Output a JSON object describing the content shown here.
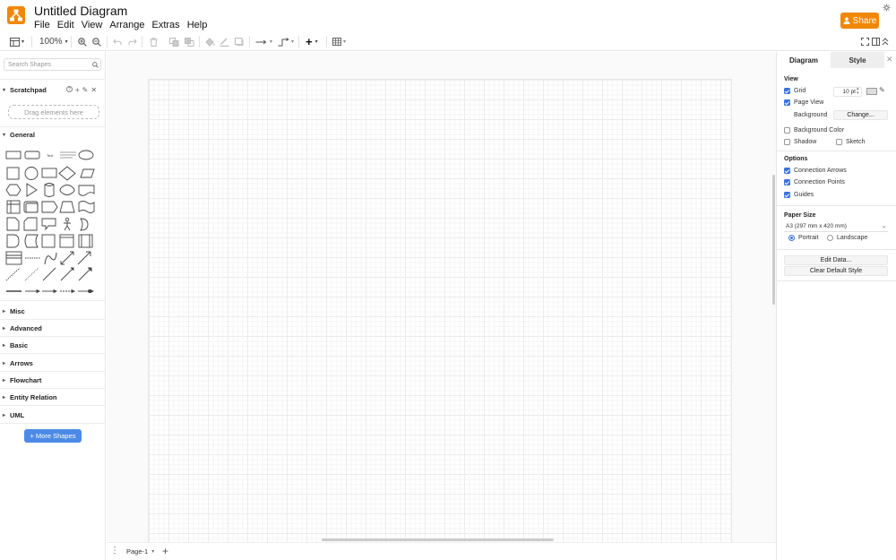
{
  "app": {
    "title": "Untitled Diagram",
    "brand_color": "#f08705",
    "accent_color": "#4d8ae8"
  },
  "menu": [
    "File",
    "Edit",
    "View",
    "Arrange",
    "Extras",
    "Help"
  ],
  "share": {
    "label": "Share",
    "icon": "user-icon"
  },
  "toolbar": {
    "zoom": "100%",
    "icons": [
      "format-panel-icon",
      "zoom-in-icon",
      "zoom-out-icon",
      "undo-icon",
      "redo-icon",
      "delete-icon",
      "to-front-icon",
      "to-back-icon",
      "fill-color-icon",
      "line-color-icon",
      "shadow-icon",
      "connection-icon",
      "waypoints-icon",
      "insert-icon",
      "table-icon",
      "fullscreen-icon",
      "format-toggle-icon",
      "collapse-icon"
    ]
  },
  "sidebar": {
    "search_placeholder": "Search Shapes",
    "scratchpad": "Scratchpad",
    "drop_hint": "Drag elements here",
    "general": "General",
    "sections": [
      "Misc",
      "Advanced",
      "Basic",
      "Arrows",
      "Flowchart",
      "Entity Relation",
      "UML"
    ],
    "more_shapes": "+ More Shapes"
  },
  "pages": {
    "current": "Page-1"
  },
  "panel": {
    "tabs": [
      "Diagram",
      "Style"
    ],
    "view_title": "View",
    "grid": {
      "label": "Grid",
      "checked": true,
      "size": "10 pt"
    },
    "page_view": {
      "label": "Page View",
      "checked": true
    },
    "background": {
      "label": "Background",
      "button": "Change..."
    },
    "background_color": {
      "label": "Background Color",
      "checked": false
    },
    "shadow": {
      "label": "Shadow",
      "checked": false
    },
    "sketch": {
      "label": "Sketch",
      "checked": false
    },
    "options_title": "Options",
    "connection_arrows": {
      "label": "Connection Arrows",
      "checked": true
    },
    "connection_points": {
      "label": "Connection Points",
      "checked": true
    },
    "guides": {
      "label": "Guides",
      "checked": true
    },
    "paper_title": "Paper Size",
    "paper_size": "A3 (297 mm x 420 mm)",
    "orientation": {
      "portrait": "Portrait",
      "landscape": "Landscape",
      "selected": "Portrait"
    },
    "edit_data": "Edit Data...",
    "clear_style": "Clear Default Style"
  }
}
